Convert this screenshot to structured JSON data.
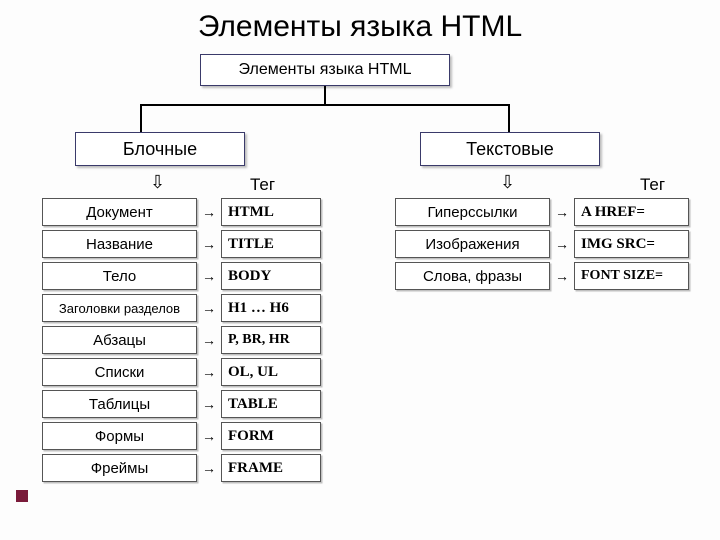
{
  "title": "Элементы языка HTML",
  "subtitle": "Элементы языка HTML",
  "tag_header": "Тег",
  "categories": {
    "block": "Блочные",
    "text": "Текстовые"
  },
  "block_rows": [
    {
      "name": "Документ",
      "tag": "HTML"
    },
    {
      "name": "Название",
      "tag": "TITLE"
    },
    {
      "name": "Тело",
      "tag": "BODY"
    },
    {
      "name": "Заголовки разделов",
      "tag": "H1 … H6"
    },
    {
      "name": "Абзацы",
      "tag": "P, BR, HR"
    },
    {
      "name": "Списки",
      "tag": "OL, UL"
    },
    {
      "name": "Таблицы",
      "tag": "TABLE"
    },
    {
      "name": "Формы",
      "tag": "FORM"
    },
    {
      "name": "Фреймы",
      "tag": "FRAME"
    }
  ],
  "text_rows": [
    {
      "name": "Гиперссылки",
      "tag": "A HREF="
    },
    {
      "name": "Изображения",
      "tag": "IMG SRC="
    },
    {
      "name": "Слова, фразы",
      "tag": "FONT SIZE="
    }
  ]
}
